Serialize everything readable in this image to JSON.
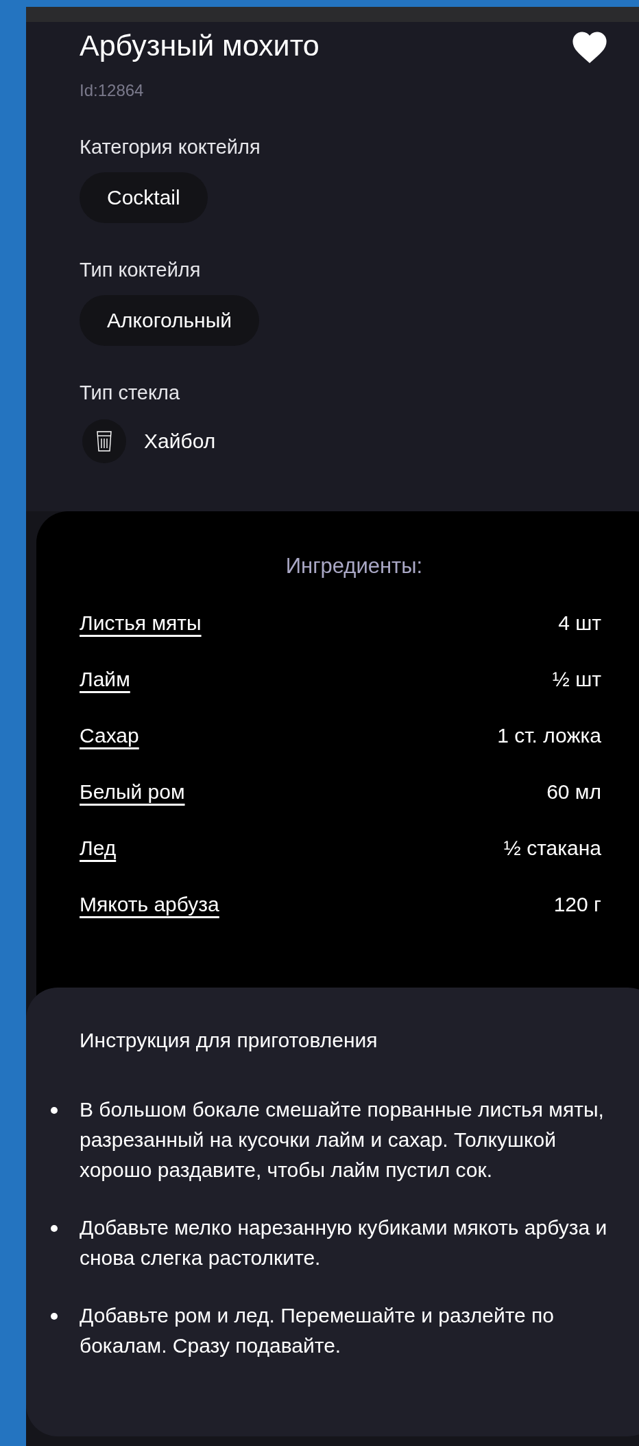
{
  "title": "Арбузный мохито",
  "favorite": true,
  "id_label": "Id:12864",
  "category": {
    "label": "Категория коктейля",
    "value": "Cocktail"
  },
  "cocktail_type": {
    "label": "Тип коктейля",
    "value": "Алкогольный"
  },
  "glass": {
    "label": "Тип стекла",
    "value": "Хайбол"
  },
  "ingredients": {
    "heading": "Ингредиенты:",
    "items": [
      {
        "name": "Листья мяты",
        "amount": "4 шт"
      },
      {
        "name": "Лайм",
        "amount": "½ шт"
      },
      {
        "name": "Сахар",
        "amount": "1 ст. ложка"
      },
      {
        "name": "Белый ром",
        "amount": "60 мл"
      },
      {
        "name": "Лед",
        "amount": "½ стакана"
      },
      {
        "name": "Мякоть арбуза",
        "amount": "120 г"
      }
    ]
  },
  "instructions": {
    "heading": "Инструкция для приготовления",
    "steps": [
      "В большом бокале смешайте порванные листья мяты, разрезанный на кусочки лайм и сахар. Толкушкой хорошо раздавите, чтобы лайм пустил сок.",
      "Добавьте мелко нарезанную кубиками мякоть арбуза и снова слегка растолките.",
      "Добавьте ром и лед. Перемешайте и разлейте по бокалам. Сразу подавайте."
    ]
  }
}
